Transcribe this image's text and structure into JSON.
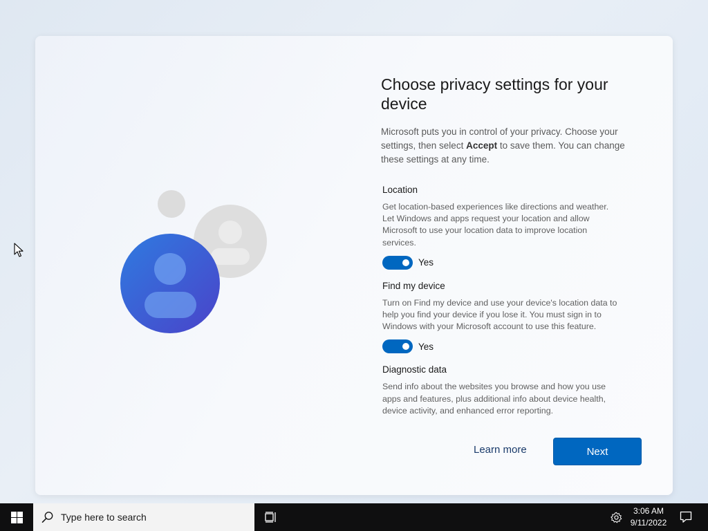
{
  "dialog": {
    "title": "Choose privacy settings for your device",
    "intro_before": "Microsoft puts you in control of your privacy. Choose your settings, then select ",
    "intro_bold": "Accept",
    "intro_after": " to save them. You can change these settings at any time.",
    "illustration_icon": "people-icon"
  },
  "settings": [
    {
      "title": "Location",
      "description": "Get location-based experiences like directions and weather. Let Windows and apps request your location and allow Microsoft to use your location data to improve location services.",
      "toggle_on": true,
      "toggle_label": "Yes"
    },
    {
      "title": "Find my device",
      "description": "Turn on Find my device and use your device's location data to help you find your device if you lose it. You must sign in to Windows with your Microsoft account to use this feature.",
      "toggle_on": true,
      "toggle_label": "Yes"
    },
    {
      "title": "Diagnostic data",
      "description": "Send info about the websites you browse and how you use apps and features, plus additional info about device health, device activity, and enhanced error reporting."
    }
  ],
  "buttons": {
    "learn_more": "Learn more",
    "next": "Next"
  },
  "taskbar": {
    "search_placeholder": "Type here to search",
    "time": "3:06 AM",
    "date": "9/11/2022"
  },
  "colors": {
    "accent": "#0067c0",
    "taskbar": "#0f0f10"
  }
}
